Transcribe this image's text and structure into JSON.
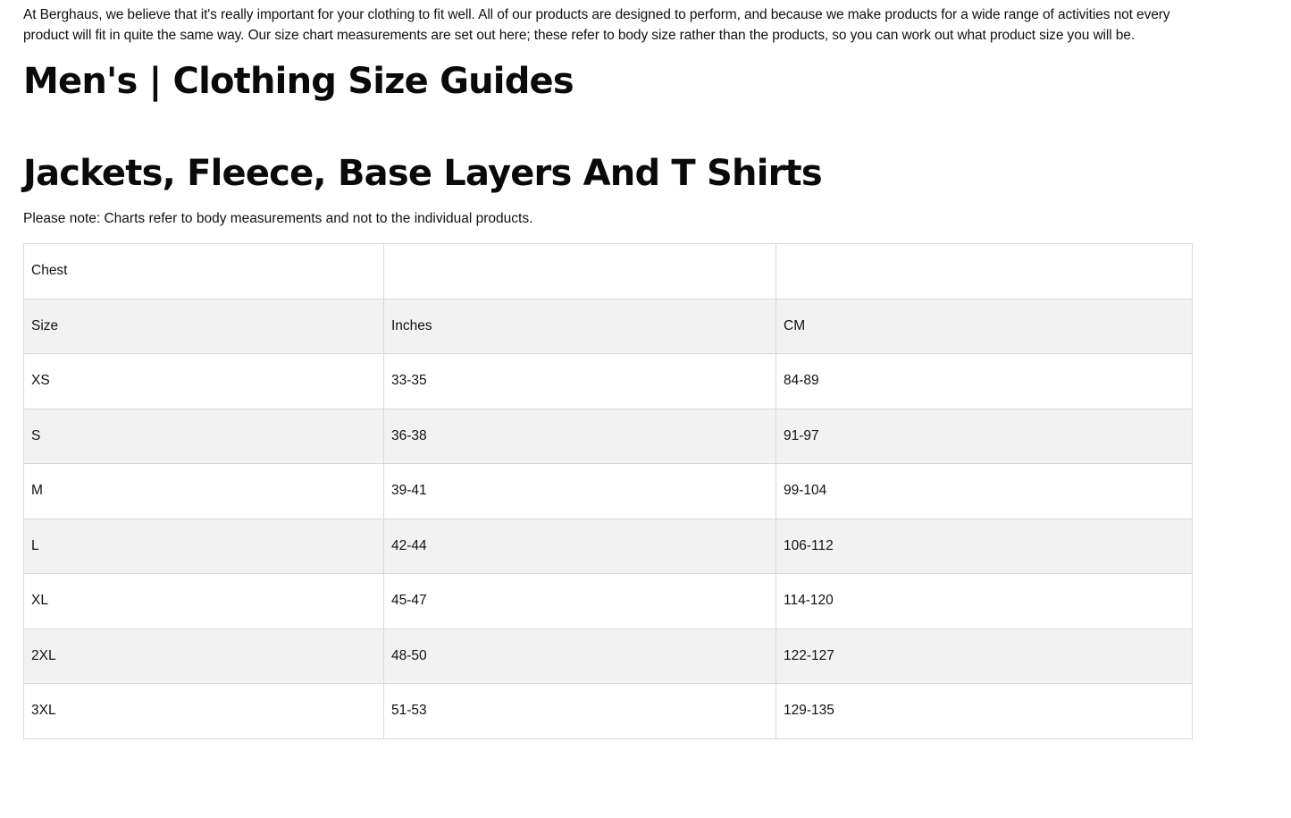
{
  "intro": {
    "text": "At Berghaus, we believe that it's really important for your clothing to fit well. All of our products are designed to perform, and because we make products for a wide range of activities not every product will fit in quite the same way. Our size chart measurements are set out here; these refer to body size rather than the products, so you can work out what product size you will be."
  },
  "page_title": "Men's | Clothing Size Guides",
  "section": {
    "title": "Jackets, Fleece, Base Layers And T Shirts",
    "note": "Please note: Charts refer to body measurements and not to the individual products."
  },
  "table": {
    "rows": [
      [
        "Chest",
        "",
        ""
      ],
      [
        "Size",
        "Inches",
        "CM"
      ],
      [
        "XS",
        "33-35",
        "84-89"
      ],
      [
        "S",
        "36-38",
        "91-97"
      ],
      [
        "M",
        "39-41",
        "99-104"
      ],
      [
        "L",
        "42-44",
        "106-112"
      ],
      [
        "XL",
        "45-47",
        "114-120"
      ],
      [
        "2XL",
        "48-50",
        "122-127"
      ],
      [
        "3XL",
        "51-53",
        "129-135"
      ]
    ]
  }
}
